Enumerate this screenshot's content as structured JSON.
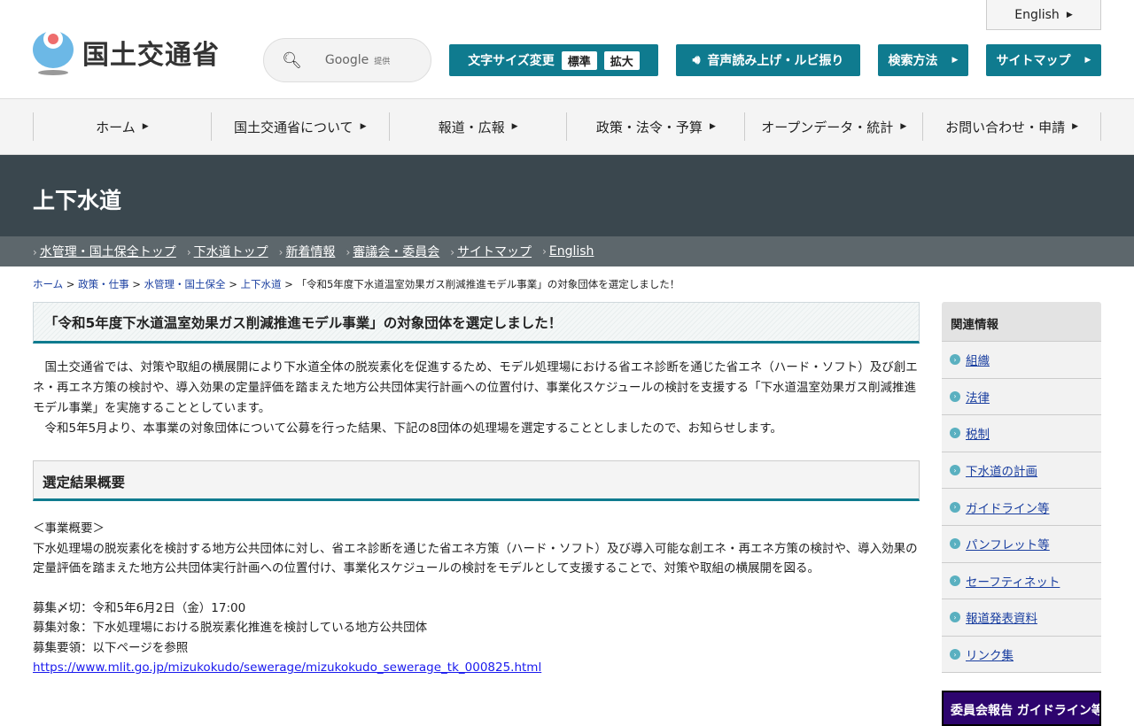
{
  "header": {
    "logo_text": "国土交通省",
    "search_brand": "Google",
    "search_provided": "提供",
    "font_size_label": "文字サイズ変更",
    "font_standard": "標準",
    "font_large": "拡大",
    "speech_label": "音声読み上げ・ルビ振り",
    "search_method": "検索方法",
    "sitemap": "サイトマップ",
    "english": "English"
  },
  "gnav": [
    "ホーム",
    "国土交通省について",
    "報道・広報",
    "政策・法令・予算",
    "オープンデータ・統計",
    "お問い合わせ・申請"
  ],
  "band_title": "上下水道",
  "subnav": [
    "水管理・国土保全トップ",
    "下水道トップ",
    "新着情報",
    "審議会・委員会",
    "サイトマップ",
    "English"
  ],
  "breadcrumb": {
    "links": [
      "ホーム",
      "政策・仕事",
      "水管理・国土保全",
      "上下水道"
    ],
    "current": "「令和5年度下水道温室効果ガス削減推進モデル事業」の対象団体を選定しました！"
  },
  "main": {
    "title": "「令和5年度下水道温室効果ガス削減推進モデル事業」の対象団体を選定しました！",
    "para1": "　国土交通省では、対策や取組の横展開により下水道全体の脱炭素化を促進するため、モデル処理場における省エネ診断を通じた省エネ（ハード・ソフト）及び創エネ・再エネ方策の検討や、導入効果の定量評価を踏まえた地方公共団体実行計画への位置付け、事業化スケジュールの検討を支援する「下水道温室効果ガス削減推進モデル事業」を実施することとしています。",
    "para2": "　令和5年5月より、本事業の対象団体について公募を行った結果、下記の8団体の処理場を選定することとしましたので、お知らせします。",
    "section_title": "選定結果概要",
    "overview_heading": "＜事業概要＞",
    "overview": "下水処理場の脱炭素化を検討する地方公共団体に対し、省エネ診断を通じた省エネ方策（ハード・ソフト）及び導入可能な創エネ・再エネ方策の検討や、導入効果の定量評価を踏まえた地方公共団体実行計画への位置付け、事業化スケジュールの検討をモデルとして支援することで、対策や取組の横展開を図る。",
    "deadline": "募集〆切：令和5年6月2日（金）17:00",
    "target": "募集対象：下水処理場における脱炭素化推進を検討している地方公共団体",
    "guideline": "募集要領：以下ページを参照",
    "url": "https://www.mlit.go.jp/mizukokudo/sewerage/mizukokudo_sewerage_tk_000825.html"
  },
  "sidebar": {
    "heading": "関連情報",
    "items": [
      "組織",
      "法律",
      "税制",
      "下水道の計画",
      "ガイドライン等",
      "パンフレット等",
      "セーフティネット",
      "報道発表資料",
      "リンク集"
    ],
    "banner": "委員会報告 ガイドライン等"
  }
}
